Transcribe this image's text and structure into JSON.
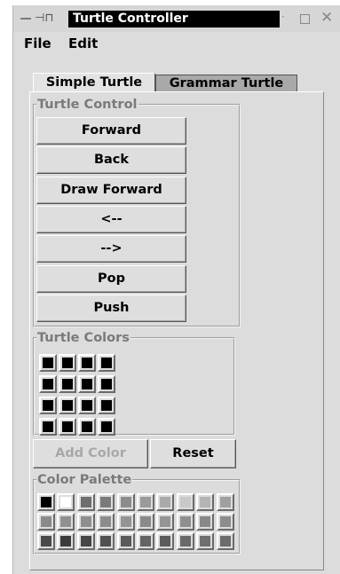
{
  "window": {
    "title": "Turtle Controller"
  },
  "menu": {
    "file": "File",
    "edit": "Edit"
  },
  "tabs": [
    {
      "label": "Simple Turtle",
      "selected": true
    },
    {
      "label": "Grammar Turtle",
      "selected": false
    }
  ],
  "turtle_control": {
    "title": "Turtle Control",
    "buttons": [
      "Forward",
      "Back",
      "Draw Forward",
      "<--",
      "-->",
      "Pop",
      "Push"
    ]
  },
  "turtle_colors": {
    "title": "Turtle Colors",
    "swatches": [
      "#000000",
      "#000000",
      "#000000",
      "#000000",
      "#000000",
      "#000000",
      "#000000",
      "#000000",
      "#000000",
      "#000000",
      "#000000",
      "#000000",
      "#000000",
      "#000000",
      "#000000",
      "#000000"
    ],
    "add_color": "Add Color",
    "reset": "Reset"
  },
  "color_palette": {
    "title": "Color Palette",
    "swatches": [
      "#000000",
      "#ffffff",
      "#6e6e6e",
      "#7a7a7a",
      "#8c8c8c",
      "#9a9a9a",
      "#aaaaaa",
      "#c8c8c8",
      "#b4b4b4",
      "#a0a0a0",
      "#8a8a8a",
      "#909090",
      "#8e8e8e",
      "#8c8c8c",
      "#949494",
      "#8a8a8a",
      "#959595",
      "#8f8f8f",
      "#888888",
      "#8c8c8c",
      "#4a4a4a",
      "#3c3c3c",
      "#464646",
      "#505050",
      "#5a5a5a",
      "#646464",
      "#5c5c5c",
      "#6a6a6a",
      "#707070",
      "#6c6c6c"
    ]
  },
  "colors": {
    "titlebar_active": "#000000",
    "disabled_text": "#a8a8a8",
    "legend_text": "#7a7a7a"
  }
}
